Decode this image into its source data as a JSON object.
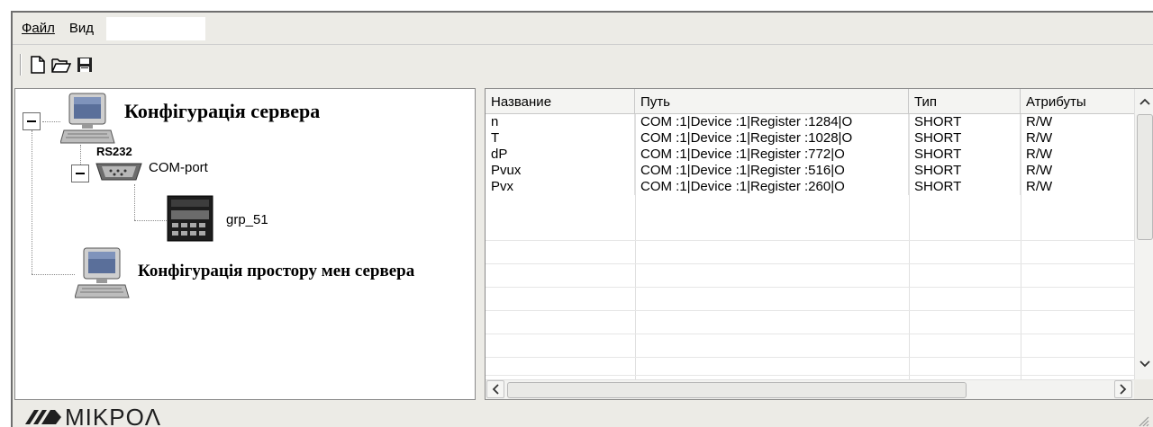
{
  "menu": {
    "file": "Файл",
    "view": "Вид"
  },
  "toolbar": {
    "new_icon": "new-file-icon",
    "open_icon": "open-folder-icon",
    "save_icon": "save-disk-icon"
  },
  "tree": {
    "server_config": "Конфігурація сервера",
    "rs232": "RS232",
    "com_port": "COM-port",
    "device": "grp_51",
    "namespace_config": "Конфігурація простору мен сервера"
  },
  "table": {
    "columns": [
      "Название",
      "Путь",
      "Тип",
      "Атрибуты"
    ],
    "rows": [
      [
        "n",
        "COM :1|Device :1|Register :1284|O",
        "SHORT",
        "R/W"
      ],
      [
        "T",
        "COM :1|Device :1|Register :1028|O",
        "SHORT",
        "R/W"
      ],
      [
        "dP",
        "COM :1|Device :1|Register :772|O",
        "SHORT",
        "R/W"
      ],
      [
        "Pvux",
        "COM :1|Device :1|Register :516|O",
        "SHORT",
        "R/W"
      ],
      [
        "Pvx",
        "COM :1|Device :1|Register :260|O",
        "SHORT",
        "R/W"
      ]
    ]
  },
  "status": {
    "logo_text": "MIKPOΛ"
  }
}
